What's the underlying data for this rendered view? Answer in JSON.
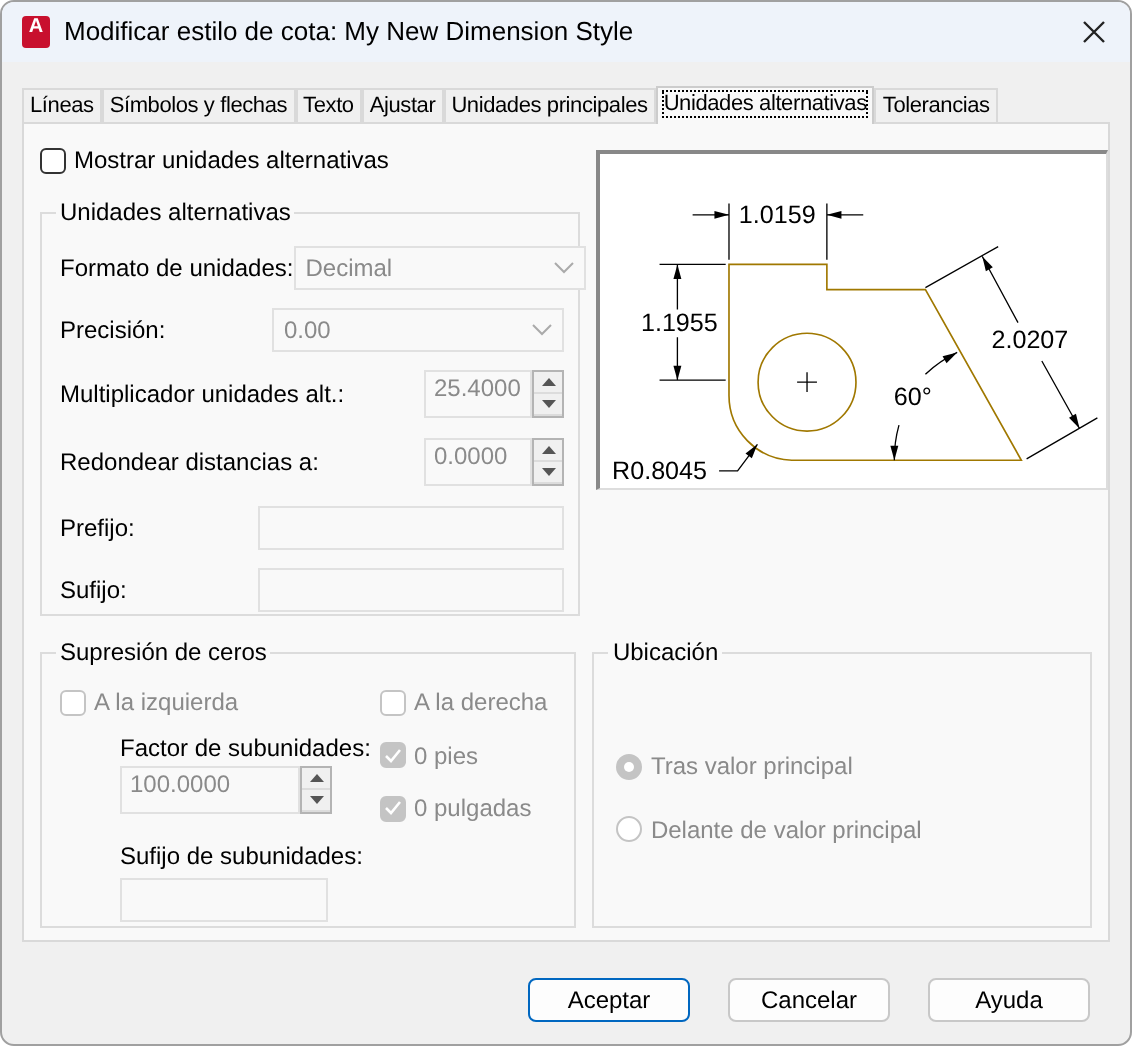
{
  "window": {
    "title": "Modificar estilo de cota: My New Dimension Style",
    "app_icon_letter": "A"
  },
  "tabs": [
    {
      "label": "Líneas",
      "selected": false
    },
    {
      "label": "Símbolos y flechas",
      "selected": false
    },
    {
      "label": "Texto",
      "selected": false
    },
    {
      "label": "Ajustar",
      "selected": false
    },
    {
      "label": "Unidades principales",
      "selected": false
    },
    {
      "label": "Unidades alternativas",
      "selected": true
    },
    {
      "label": "Tolerancias",
      "selected": false
    }
  ],
  "show_alternate": {
    "label": "Mostrar unidades alternativas",
    "checked": false
  },
  "alternate_units": {
    "title": "Unidades alternativas",
    "rows": [
      {
        "kind": "select",
        "label": "Formato de unidades:",
        "value": "Decimal",
        "disabled": true
      },
      {
        "kind": "select",
        "label": "Precisión:",
        "value": "0.00",
        "disabled": true
      },
      {
        "kind": "spin",
        "label": "Multiplicador unidades alt.:",
        "value": "25.4000",
        "disabled": true
      },
      {
        "kind": "spin",
        "label": "Redondear distancias a:",
        "value": "0.0000",
        "disabled": true
      },
      {
        "kind": "text",
        "label": "Prefijo:",
        "disabled": true
      },
      {
        "kind": "text",
        "label": "Sufijo:",
        "disabled": true
      }
    ]
  },
  "preview": {
    "labels": [
      "1.0159",
      "1.1955",
      "2.0207",
      "60°",
      "R0.8045"
    ]
  },
  "zero_suppression": {
    "title": "Supresión de ceros",
    "leading": {
      "label": "A la izquierda",
      "checked": false,
      "disabled": true
    },
    "trailing": {
      "label": "A la derecha",
      "checked": false,
      "disabled": true
    },
    "sub_units_factor": {
      "label": "Factor de subunidades:",
      "value": "100.0000",
      "disabled": true
    },
    "sub_units_suffix": {
      "label": "Sufijo de subunidades:",
      "disabled": true
    },
    "feet": {
      "label": "0 pies",
      "checked": true,
      "disabled": true
    },
    "inches": {
      "label": "0 pulgadas",
      "checked": true,
      "disabled": true
    }
  },
  "placement": {
    "title": "Ubicación",
    "options": [
      {
        "label": "Tras valor principal",
        "selected": true,
        "disabled": true
      },
      {
        "label": "Delante de valor principal",
        "selected": false,
        "disabled": true
      }
    ]
  },
  "buttons": [
    {
      "label": "Aceptar",
      "focused": true
    },
    {
      "label": "Cancelar",
      "focused": false
    },
    {
      "label": "Ayuda",
      "focused": false
    }
  ]
}
